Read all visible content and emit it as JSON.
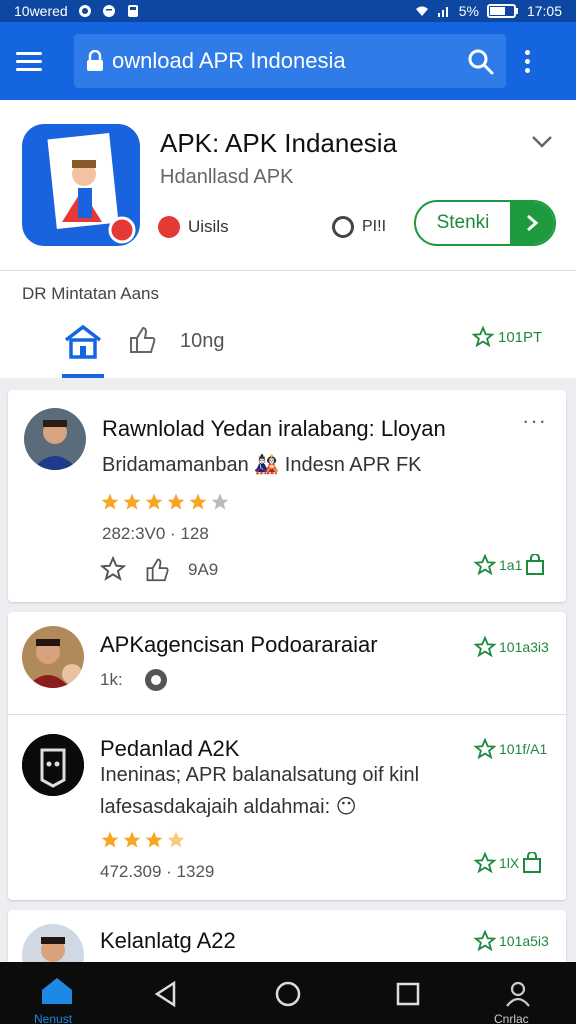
{
  "status_bar": {
    "carrier": "10wered",
    "battery": "5%",
    "time": "17:05"
  },
  "app_bar": {
    "search_query": "ownload APR Indonesia",
    "icons": [
      "menu-icon",
      "lock-icon",
      "search-icon",
      "more-vert-icon"
    ]
  },
  "app": {
    "title": "APK: APK Indanesia",
    "developer": "Hdanllasd APK",
    "users_label": "Uisils",
    "permissions_label": "PI!I",
    "install_label": "Stenki",
    "section_title": "DR Mintatan Aans",
    "tabs": {
      "count_label": "10ng",
      "rating_label": "101PT"
    },
    "colors": {
      "accent": "#1565e0",
      "green": "#1e9a3e"
    }
  },
  "cards": [
    {
      "title": "Rawnlolad  Yedan iralabang: Lloyan",
      "subtitle": "Bridamamanban",
      "subtitle_suffix": "Indesn APR FK",
      "rating": 4.5,
      "meta": "282:3V0 · 128",
      "likes": "9A9",
      "badge": "1a1",
      "more": "···"
    },
    {
      "title": "APKagencisan Podoararaiar",
      "meta": "1k:",
      "badge": "101a3i3"
    },
    {
      "title": "Pedanlad A2K",
      "line1": "Ineninas; APR balanalsatung oif kinl",
      "line2": "lafesasdakajaih aldahmai:",
      "rating": 3.5,
      "meta": "472.309 · 1329",
      "badge_top": "101f/A1",
      "badge_bottom": "1lX"
    },
    {
      "title": "Kelanlatg A22",
      "badge": "101a5i3"
    }
  ],
  "nav": {
    "home_label": "Nenust",
    "profile_label": "Cnrlac"
  }
}
